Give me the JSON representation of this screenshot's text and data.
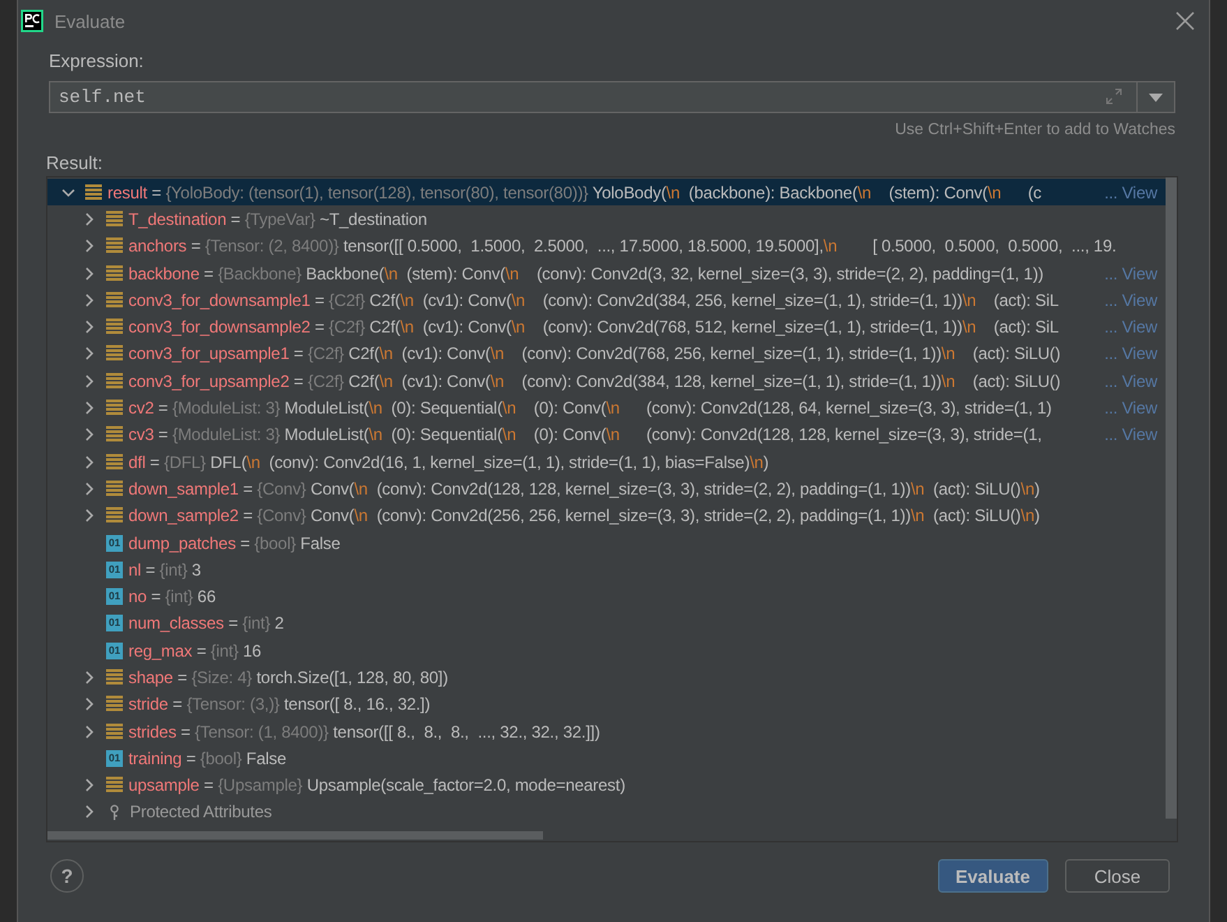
{
  "window": {
    "title": "Evaluate"
  },
  "expression": {
    "label": "Expression:",
    "value": "self.net",
    "hint": "Use Ctrl+Shift+Enter to add to Watches"
  },
  "result": {
    "label": "Result:",
    "separator": "=",
    "tree": {
      "kind": "node",
      "name": "result",
      "type": "{YoloBody: (tensor(1), tensor(128), tensor(80), tensor(80))}",
      "value": "YoloBody(\\n  (backbone): Backbone(\\n    (stem): Conv(\\n      (c",
      "link": "... View",
      "expanded": true,
      "selected": true,
      "children": [
        {
          "kind": "node",
          "name": "T_destination",
          "type": "{TypeVar}",
          "value": "~T_destination",
          "expanded": false,
          "selected": false
        },
        {
          "kind": "node",
          "name": "anchors",
          "type": "{Tensor: (2, 8400)}",
          "value": "tensor([[ 0.5000,  1.5000,  2.5000,  ..., 17.5000, 18.5000, 19.5000],\\n        [ 0.5000,  0.5000,  0.5000,  ..., 19.",
          "expanded": false,
          "selected": false
        },
        {
          "kind": "node",
          "name": "backbone",
          "type": "{Backbone}",
          "value": "Backbone(\\n  (stem): Conv(\\n    (conv): Conv2d(3, 32, kernel_size=(3, 3), stride=(2, 2), padding=(1, 1))",
          "link": "... View",
          "expanded": false,
          "selected": false
        },
        {
          "kind": "node",
          "name": "conv3_for_downsample1",
          "type": "{C2f}",
          "value": "C2f(\\n  (cv1): Conv(\\n    (conv): Conv2d(384, 256, kernel_size=(1, 1), stride=(1, 1))\\n    (act): SiL",
          "link": "... View",
          "expanded": false,
          "selected": false
        },
        {
          "kind": "node",
          "name": "conv3_for_downsample2",
          "type": "{C2f}",
          "value": "C2f(\\n  (cv1): Conv(\\n    (conv): Conv2d(768, 512, kernel_size=(1, 1), stride=(1, 1))\\n    (act): SiL",
          "link": "... View",
          "expanded": false,
          "selected": false
        },
        {
          "kind": "node",
          "name": "conv3_for_upsample1",
          "type": "{C2f}",
          "value": "C2f(\\n  (cv1): Conv(\\n    (conv): Conv2d(768, 256, kernel_size=(1, 1), stride=(1, 1))\\n    (act): SiLU()",
          "link": "... View",
          "expanded": false,
          "selected": false
        },
        {
          "kind": "node",
          "name": "conv3_for_upsample2",
          "type": "{C2f}",
          "value": "C2f(\\n  (cv1): Conv(\\n    (conv): Conv2d(384, 128, kernel_size=(1, 1), stride=(1, 1))\\n    (act): SiLU()",
          "link": "... View",
          "expanded": false,
          "selected": false
        },
        {
          "kind": "node",
          "name": "cv2",
          "type": "{ModuleList: 3}",
          "value": "ModuleList(\\n  (0): Sequential(\\n    (0): Conv(\\n      (conv): Conv2d(128, 64, kernel_size=(3, 3), stride=(1, 1)",
          "link": "... View",
          "expanded": false,
          "selected": false
        },
        {
          "kind": "node",
          "name": "cv3",
          "type": "{ModuleList: 3}",
          "value": "ModuleList(\\n  (0): Sequential(\\n    (0): Conv(\\n      (conv): Conv2d(128, 128, kernel_size=(3, 3), stride=(1,",
          "link": "... View",
          "expanded": false,
          "selected": false
        },
        {
          "kind": "node",
          "name": "dfl",
          "type": "{DFL}",
          "value": "DFL(\\n  (conv): Conv2d(16, 1, kernel_size=(1, 1), stride=(1, 1), bias=False)\\n)",
          "expanded": false,
          "selected": false
        },
        {
          "kind": "node",
          "name": "down_sample1",
          "type": "{Conv}",
          "value": "Conv(\\n  (conv): Conv2d(128, 128, kernel_size=(3, 3), stride=(2, 2), padding=(1, 1))\\n  (act): SiLU()\\n)",
          "expanded": false,
          "selected": false
        },
        {
          "kind": "node",
          "name": "down_sample2",
          "type": "{Conv}",
          "value": "Conv(\\n  (conv): Conv2d(256, 256, kernel_size=(3, 3), stride=(2, 2), padding=(1, 1))\\n  (act): SiLU()\\n)",
          "expanded": false,
          "selected": false
        },
        {
          "kind": "leaf",
          "badge": "01",
          "name": "dump_patches",
          "type": "{bool}",
          "value": "False",
          "selected": false
        },
        {
          "kind": "leaf",
          "badge": "01",
          "name": "nl",
          "type": "{int}",
          "value": "3",
          "selected": false
        },
        {
          "kind": "leaf",
          "badge": "01",
          "name": "no",
          "type": "{int}",
          "value": "66",
          "selected": false
        },
        {
          "kind": "leaf",
          "badge": "01",
          "name": "num_classes",
          "type": "{int}",
          "value": "2",
          "selected": false
        },
        {
          "kind": "leaf",
          "badge": "01",
          "name": "reg_max",
          "type": "{int}",
          "value": "16",
          "selected": false
        },
        {
          "kind": "node",
          "name": "shape",
          "type": "{Size: 4}",
          "value": "torch.Size([1, 128, 80, 80])",
          "expanded": false,
          "selected": false
        },
        {
          "kind": "node",
          "name": "stride",
          "type": "{Tensor: (3,)}",
          "value": "tensor([ 8., 16., 32.])",
          "expanded": false,
          "selected": false
        },
        {
          "kind": "node",
          "name": "strides",
          "type": "{Tensor: (1, 8400)}",
          "value": "tensor([[ 8.,  8.,  8.,  ..., 32., 32., 32.]])",
          "expanded": false,
          "selected": false
        },
        {
          "kind": "leaf",
          "badge": "01",
          "name": "training",
          "type": "{bool}",
          "value": "False",
          "selected": false
        },
        {
          "kind": "node",
          "name": "upsample",
          "type": "{Upsample}",
          "value": "Upsample(scale_factor=2.0, mode=nearest)",
          "expanded": false,
          "selected": false
        },
        {
          "kind": "group",
          "name": "Protected Attributes",
          "expanded": false,
          "selected": false
        }
      ]
    }
  },
  "buttons": [
    {
      "label": "Evaluate",
      "primary": true
    },
    {
      "label": "Close",
      "primary": false
    }
  ],
  "help": "?"
}
